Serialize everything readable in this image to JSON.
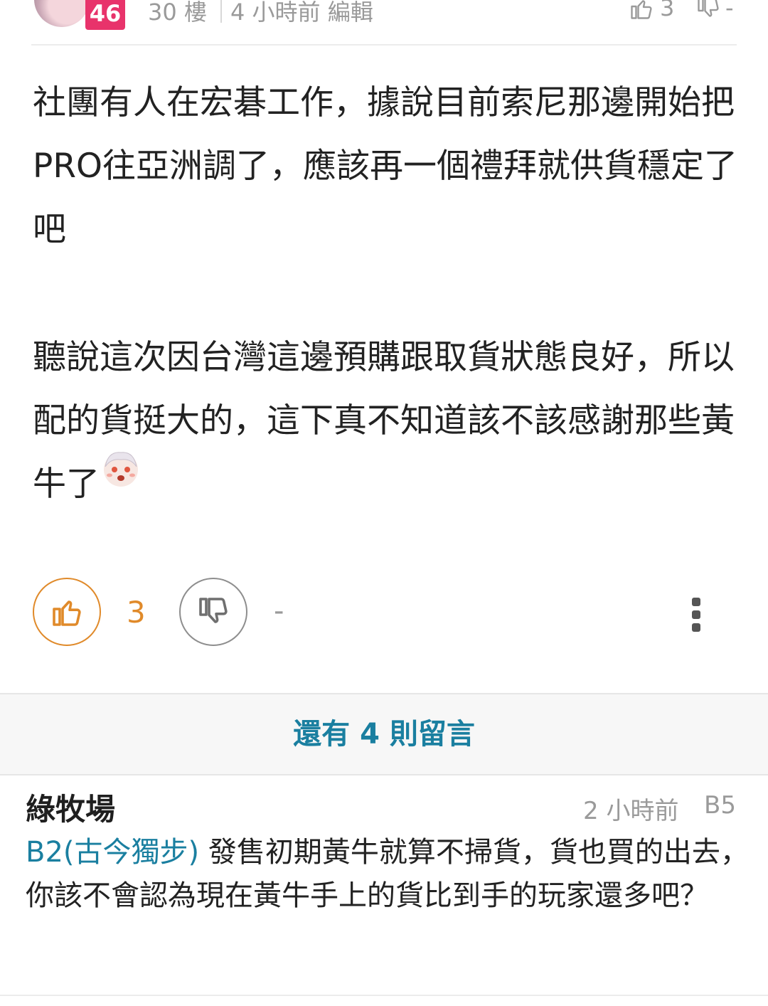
{
  "post": {
    "level": "46",
    "floor": "30 樓",
    "time_edit": "4 小時前 編輯",
    "header_like_count": "3",
    "header_dislike_count": "-",
    "paragraph1": "社團有人在宏碁工作，據說目前索尼那邊開始把PRO往亞洲調了，應該再一個禮拜就供貨穩定了吧",
    "paragraph2": "聽說這次因台灣這邊預購跟取貨狀態良好，所以配的貨挺大的，這下真不知道該不該感謝那些黃牛了",
    "like_count": "3",
    "dislike_count": "-"
  },
  "more_comments": "還有 4 則留言",
  "reply": {
    "author": "綠牧場",
    "time": "2 小時前",
    "floor": "B5",
    "mention": "B2(古今獨步)",
    "text": " 發售初期黃牛就算不掃貨，貨也買的出去，你該不會認為現在黃牛手上的貨比到手的玩家還多吧？"
  },
  "colors": {
    "accent_like": "#e08a2a",
    "link": "#1a7fa0",
    "level_badge": "#e8336b",
    "muted": "#9a9a9a"
  },
  "icons": [
    "thumb-up-icon",
    "thumb-down-icon",
    "more-vertical-icon",
    "emoji-sticker-icon"
  ]
}
